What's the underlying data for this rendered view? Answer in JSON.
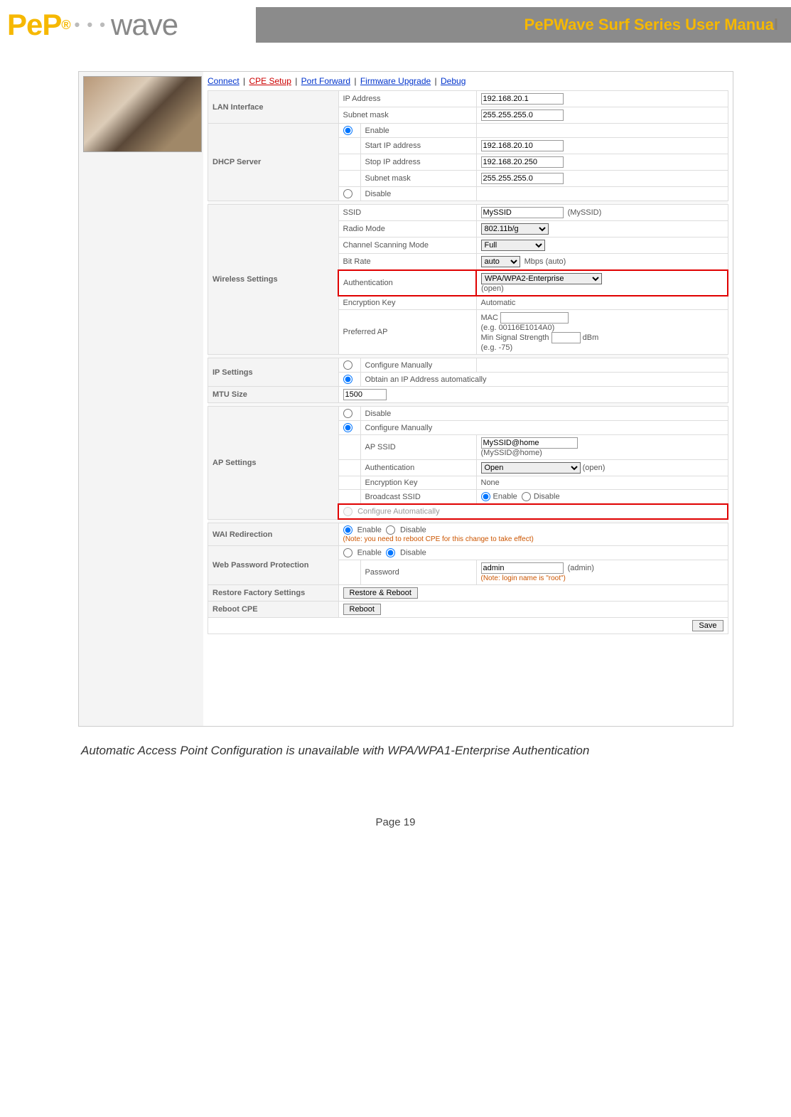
{
  "header": {
    "logo_pep": "PeP",
    "logo_wave": "wave",
    "title": "PePWave Surf Series User Manua",
    "title_last": "l"
  },
  "tabs": {
    "connect": "Connect",
    "cpe": "CPE Setup",
    "port": "Port Forward",
    "fw": "Firmware Upgrade",
    "debug": "Debug"
  },
  "lan": {
    "section": "LAN Interface",
    "ip_label": "IP Address",
    "ip": "192.168.20.1",
    "mask_label": "Subnet mask",
    "mask": "255.255.255.0"
  },
  "dhcp": {
    "section": "DHCP Server",
    "enable": "Enable",
    "start_label": "Start IP address",
    "start": "192.168.20.10",
    "stop_label": "Stop IP address",
    "stop": "192.168.20.250",
    "mask_label": "Subnet mask",
    "mask": "255.255.255.0",
    "disable": "Disable"
  },
  "wifi": {
    "section": "Wireless Settings",
    "ssid_label": "SSID",
    "ssid": "MySSID",
    "ssid_note": "(MySSID)",
    "radio_label": "Radio Mode",
    "radio": "802.11b/g",
    "scan_label": "Channel Scanning Mode",
    "scan": "Full",
    "bitrate_label": "Bit Rate",
    "bitrate": "auto",
    "bitrate_note": "Mbps (auto)",
    "auth_label": "Authentication",
    "auth": "WPA/WPA2-Enterprise",
    "auth_note": "(open)",
    "enc_label": "Encryption Key",
    "enc": "Automatic",
    "pref_label": "Preferred AP",
    "mac": "MAC",
    "mac_eg": "(e.g. 00116E1014A0)",
    "sig": "Min Signal Strength",
    "sig_unit": "dBm",
    "sig_eg": "(e.g. -75)"
  },
  "ip": {
    "section": "IP Settings",
    "manual": "Configure Manually",
    "auto": "Obtain an IP Address automatically"
  },
  "mtu": {
    "section": "MTU Size",
    "val": "1500"
  },
  "ap": {
    "section": "AP Settings",
    "disable": "Disable",
    "manual": "Configure Manually",
    "ssid_label": "AP SSID",
    "ssid": "MySSID@home",
    "ssid_note": "(MySSID@home)",
    "auth_label": "Authentication",
    "auth": "Open",
    "auth_note": "(open)",
    "enc_label": "Encryption Key",
    "enc": "None",
    "bcast_label": "Broadcast SSID",
    "enable": "Enable",
    "disable2": "Disable",
    "auto": "Configure Automatically"
  },
  "wai": {
    "section": "WAI Redirection",
    "enable": "Enable",
    "disable": "Disable",
    "note": "(Note: you need to reboot CPE for this change to take effect)"
  },
  "pwd": {
    "section": "Web Password Protection",
    "enable": "Enable",
    "disable": "Disable",
    "pwd_label": "Password",
    "pwd": "admin",
    "pwd_note": "(admin)",
    "hint": "(Note: login name is \"root\")"
  },
  "restore": {
    "section": "Restore Factory Settings",
    "btn": "Restore & Reboot"
  },
  "reboot": {
    "section": "Reboot CPE",
    "btn": "Reboot"
  },
  "save": "Save",
  "caption": "Automatic Access Point Configuration is unavailable with WPA/WPA1-Enterprise Authentication",
  "footer": "Page 19"
}
